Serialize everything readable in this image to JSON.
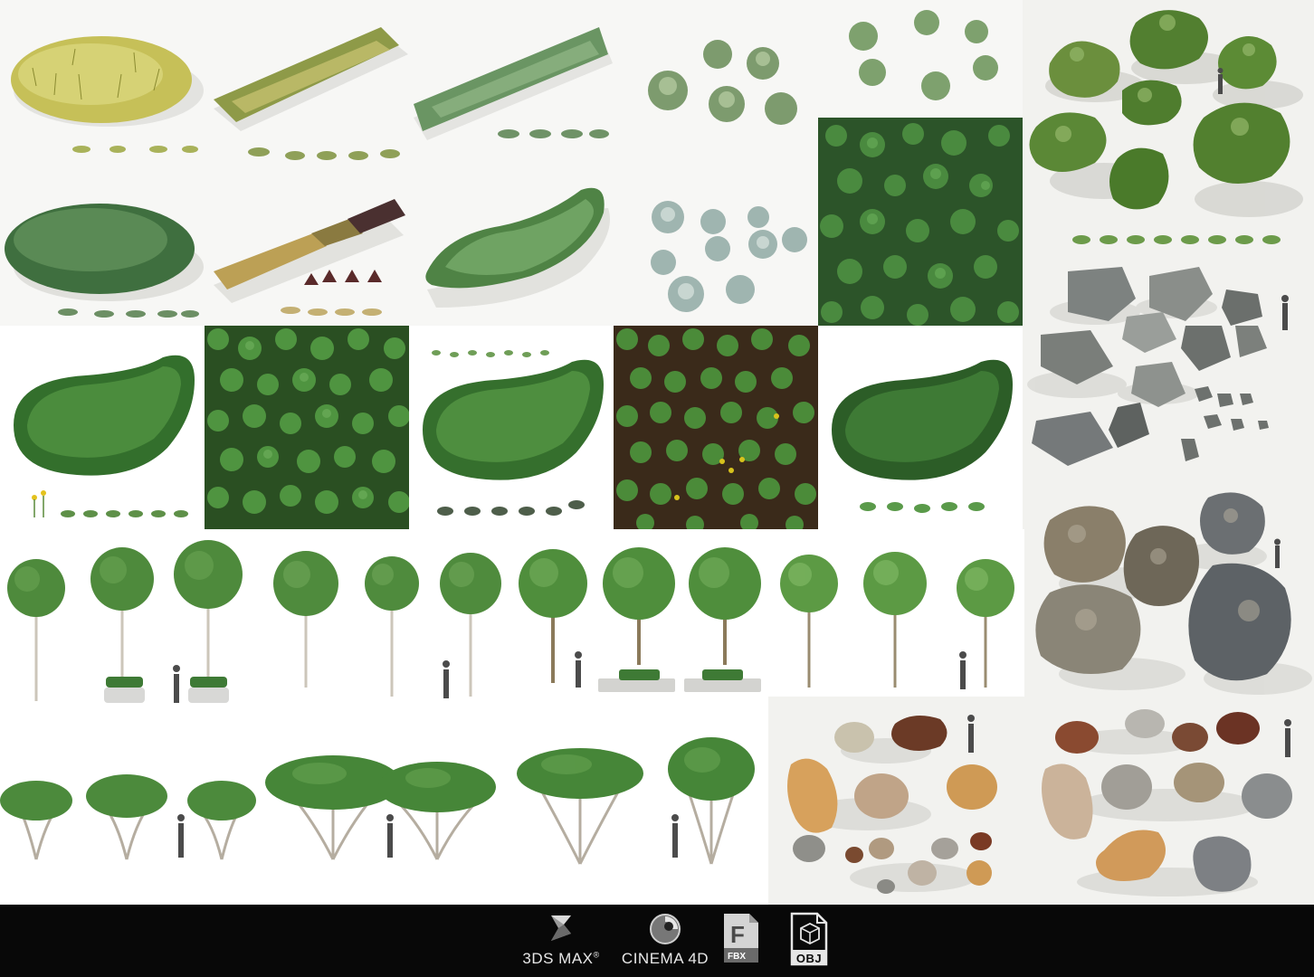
{
  "formats": [
    {
      "name": "3DS MAX",
      "mark": "®",
      "icon": "3dsmax-icon"
    },
    {
      "name": "CINEMA 4D",
      "icon": "cinema4d-icon"
    },
    {
      "name": "FBX",
      "glyph": "F",
      "icon": "fbx-file-icon"
    },
    {
      "name": "OBJ",
      "icon": "obj-file-icon"
    }
  ],
  "colors": {
    "grass_yellow": "#c9c35a",
    "grass_green": "#5f8f55",
    "grass_dark": "#3e6b3b",
    "leaf_green": "#3f7d34",
    "soil": "#3a2a1a",
    "rock_grey": "#8c8f8c",
    "moss_rock": "#5e8a3a",
    "sand_rock": "#d2a868",
    "footer_bg": "#080808"
  }
}
